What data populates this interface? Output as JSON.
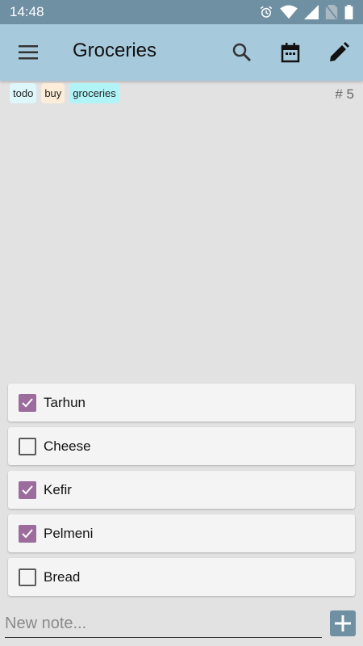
{
  "status_bar": {
    "time": "14:48",
    "icons": [
      "alarm-icon",
      "wifi-icon",
      "signal-icon",
      "no-sim-icon",
      "battery-icon"
    ]
  },
  "app_bar": {
    "title": "Groceries",
    "actions": [
      "menu-icon",
      "search-icon",
      "calendar-icon",
      "edit-icon"
    ]
  },
  "note": {
    "tags": [
      "todo",
      "buy",
      "groceries"
    ],
    "number": "# 5"
  },
  "items": [
    {
      "label": "Tarhun",
      "checked": true
    },
    {
      "label": "Cheese",
      "checked": false
    },
    {
      "label": "Kefir",
      "checked": true
    },
    {
      "label": "Pelmeni",
      "checked": true
    },
    {
      "label": "Bread",
      "checked": false
    }
  ],
  "new_note": {
    "placeholder": "New note...",
    "value": ""
  },
  "colors": {
    "status_bar": "#6f8fa3",
    "app_bar": "#a6c9dc",
    "background": "#e2e2e2",
    "checkbox_checked": "#9c6c9c",
    "add_button": "#6f8fa3"
  }
}
